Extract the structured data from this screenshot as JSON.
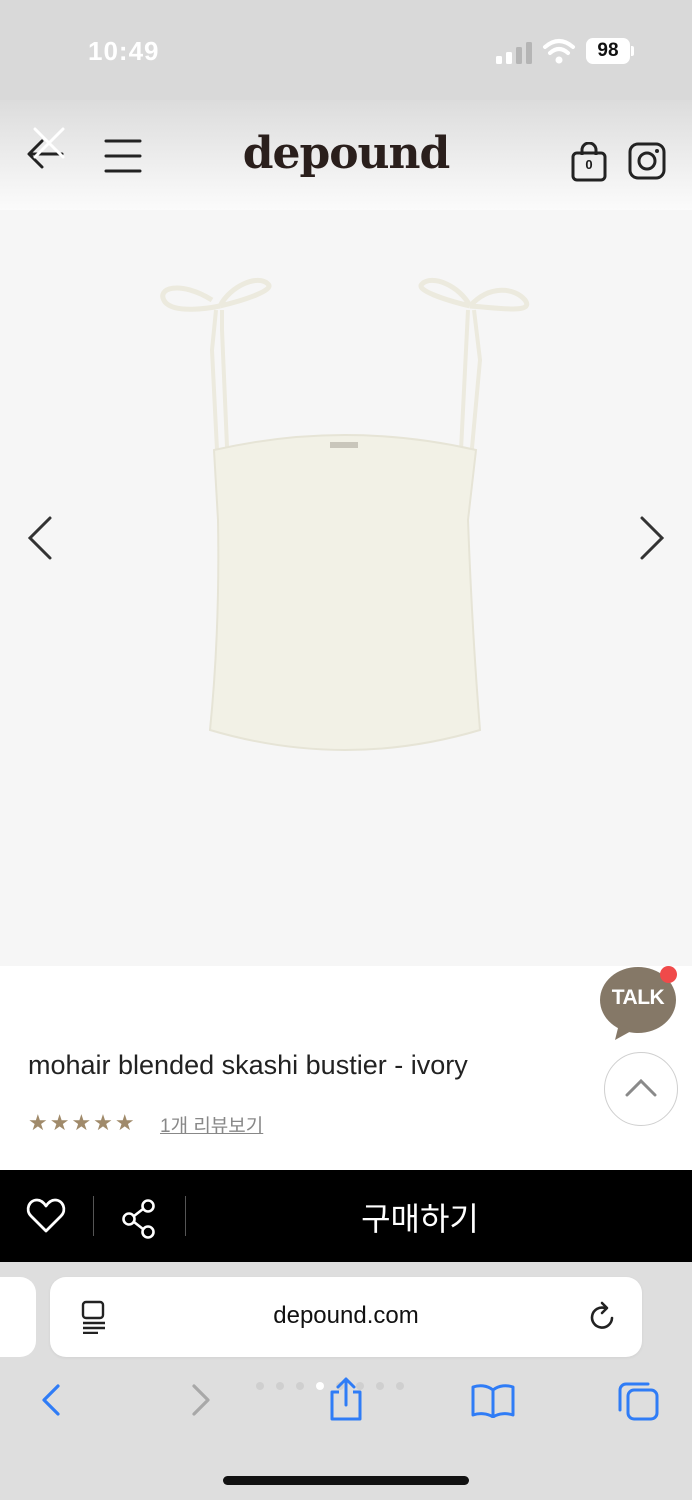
{
  "status_bar": {
    "time": "10:49",
    "battery": "98"
  },
  "header": {
    "logo": "depound",
    "cart_count": "0"
  },
  "icons": {
    "back": "back-arrow-icon",
    "close": "close-icon",
    "menu": "hamburger-menu-icon",
    "cart": "shopping-bag-icon",
    "instagram": "instagram-icon",
    "prev": "chevron-left-icon",
    "next": "chevron-right-icon",
    "heart": "heart-icon",
    "share": "share-icon",
    "reader": "reader-icon",
    "reload": "reload-icon"
  },
  "product": {
    "name": "mohair blended skashi bustier - ivory",
    "rating_stars": "★★★★★",
    "rating": 5,
    "review_link": "1개 리뷰보기"
  },
  "chat": {
    "label": "TALK"
  },
  "purchase_bar": {
    "buy_label": "구매하기"
  },
  "browser": {
    "url": "depound.com"
  },
  "colors": {
    "accent_gold": "#a08a6a",
    "chat_brown": "#857867",
    "bar_black": "#000000",
    "link_blue": "#2f7cf6"
  }
}
